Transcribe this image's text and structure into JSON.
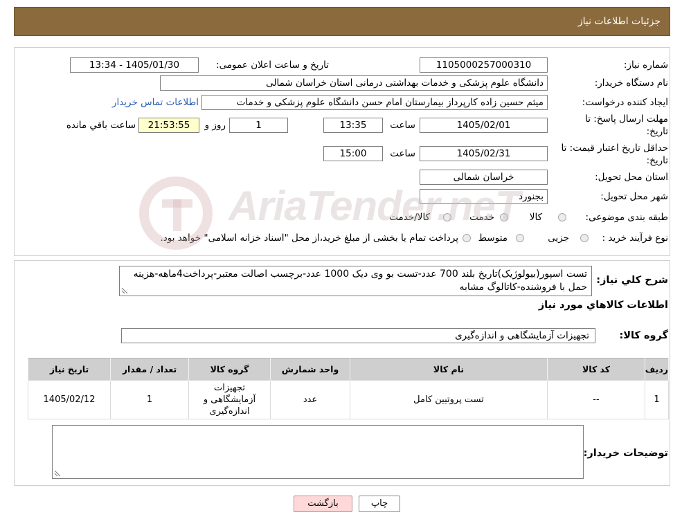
{
  "header": {
    "title": "جزئیات اطلاعات نیاز"
  },
  "watermark": "AriaTender.neT",
  "fields": {
    "need_number": {
      "label": "شماره نیاز:",
      "value": "1105000257000310"
    },
    "announce_datetime": {
      "label": "تاریخ و ساعت اعلان عمومی:",
      "value": "1405/01/30 - 13:34"
    },
    "buyer_org": {
      "label": "نام دستگاه خریدار:",
      "value": "دانشگاه علوم پزشکی و خدمات بهداشتی درمانی استان خراسان شمالی"
    },
    "requester": {
      "label": "ایجاد کننده درخواست:",
      "value": "میثم  حسین زاده  کارپرداز بیمارستان امام حسن دانشگاه علوم پزشکی و خدمات",
      "contact_link": "اطلاعات تماس خریدار"
    },
    "response_deadline": {
      "label_line1": "مهلت ارسال پاسخ: تا",
      "label_line2": "تاریخ:",
      "date": "1405/02/01",
      "time_label": "ساعت",
      "time": "13:35",
      "days": "1",
      "days_label": "روز و",
      "remaining": "21:53:55",
      "remaining_label": "ساعت باقي مانده"
    },
    "price_validity": {
      "label_line1": "حداقل تاریخ اعتبار قیمت: تا",
      "label_line2": "تاریخ:",
      "date": "1405/02/31",
      "time_label": "ساعت",
      "time": "15:00"
    },
    "delivery_province": {
      "label": "استان محل تحویل:",
      "value": "خراسان شمالی"
    },
    "delivery_city": {
      "label": "شهر محل تحویل:",
      "value": "بجنورد"
    },
    "category": {
      "label": "طبقه بندی موضوعی:",
      "options": [
        "کالا",
        "خدمت",
        "کالا/خدمت"
      ]
    },
    "purchase_type": {
      "label": "نوع فرآیند خرید :",
      "options": [
        "جزیی",
        "متوسط",
        "پرداخت تمام یا بخشی از مبلغ خرید،از محل \"اسناد خزانه اسلامی\" خواهد بود."
      ]
    }
  },
  "description": {
    "label": "شرح کلي نياز:",
    "text": "تست اسپور(بیولوژیک)تاریخ بلند 700 عدد-تست بو وی دیک 1000 عدد-برچسب اصالت معتبر-پرداخت4ماهه-هزینه حمل با فروشنده-کاتالوگ مشابه"
  },
  "goods": {
    "heading": "اطلاعات کالاهاي مورد نياز",
    "group_label": "گروه کالا:",
    "group_value": "تجهیزات آزمایشگاهی و اندازه‌گیری",
    "table": {
      "headers": [
        "ردیف",
        "کد کالا",
        "نام کالا",
        "واحد شمارش",
        "گروه کالا",
        "تعداد / مقدار",
        "تاریخ نیاز"
      ],
      "rows": [
        [
          "1",
          "--",
          "تست پروتیین کامل",
          "عدد",
          "تجهیزات آزمایشگاهی و اندازه‌گیری",
          "1",
          "1405/02/12"
        ]
      ]
    }
  },
  "buyer_notes": {
    "label": "توضیحات خریدار:",
    "value": ""
  },
  "buttons": {
    "print": "چاپ",
    "back": "بازگشت"
  },
  "icons": {
    "radio": "radio-button-icon",
    "resize": "resize-handle-icon",
    "logo": "ariatender-logo-icon"
  },
  "colors": {
    "header_bg": "#8b6b3e",
    "timer_bg": "#ffffcc",
    "link": "#2a5db0",
    "back_button_bg": "#ffd9d9",
    "table_header_bg": "#cfcfcf"
  }
}
